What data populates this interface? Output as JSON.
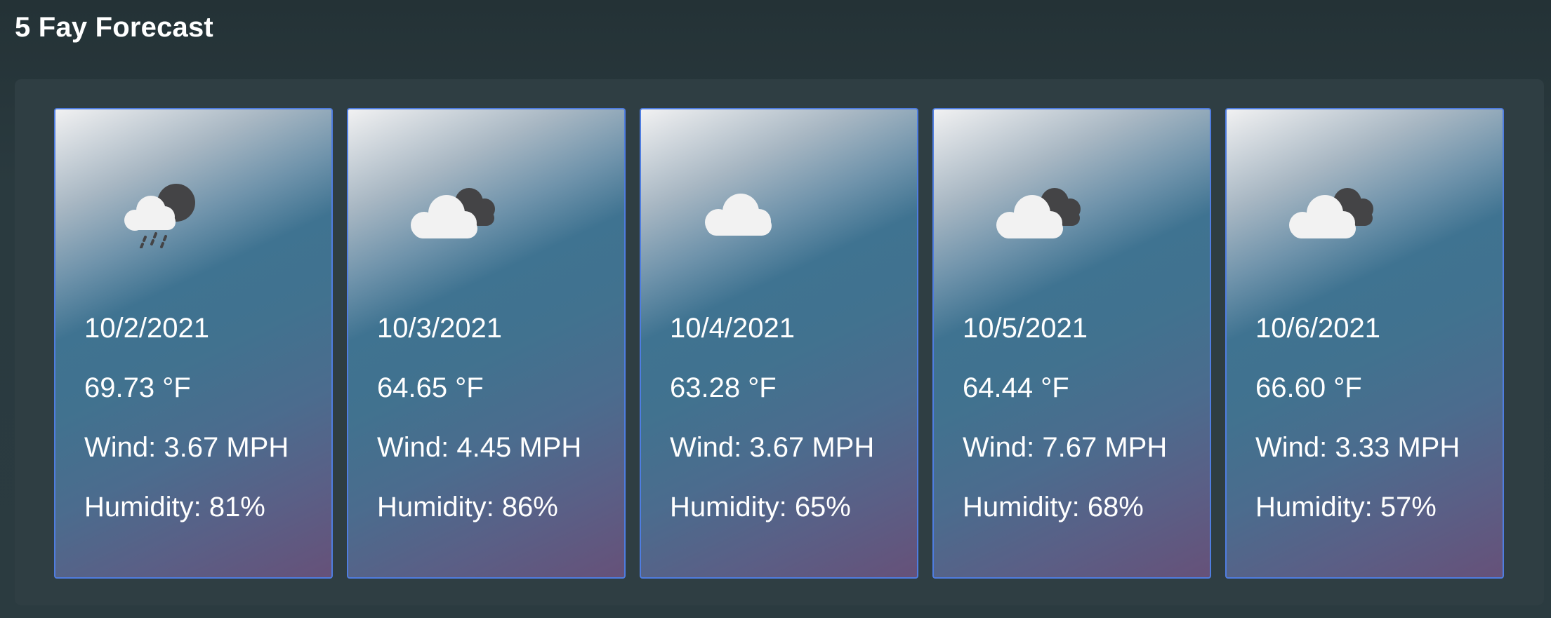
{
  "page": {
    "title": "5 Fay Forecast"
  },
  "forecast": {
    "days": [
      {
        "date": "10/2/2021",
        "temp": "69.73 °F",
        "wind": "Wind: 3.67 MPH",
        "humidity": "Humidity: 81%",
        "icon": "rain-cloud-night-icon"
      },
      {
        "date": "10/3/2021",
        "temp": "64.65 °F",
        "wind": "Wind: 4.45 MPH",
        "humidity": "Humidity: 86%",
        "icon": "broken-clouds-icon"
      },
      {
        "date": "10/4/2021",
        "temp": "63.28 °F",
        "wind": "Wind: 3.67 MPH",
        "humidity": "Humidity: 65%",
        "icon": "cloud-icon"
      },
      {
        "date": "10/5/2021",
        "temp": "64.44 °F",
        "wind": "Wind: 7.67 MPH",
        "humidity": "Humidity: 68%",
        "icon": "broken-clouds-icon"
      },
      {
        "date": "10/6/2021",
        "temp": "66.60 °F",
        "wind": "Wind: 3.33 MPH",
        "humidity": "Humidity: 57%",
        "icon": "broken-clouds-icon"
      }
    ]
  },
  "colors": {
    "page_background": "#2a3a3f",
    "panel_background": "#2f3e43",
    "card_border": "#4f7de0",
    "card_gradient_start": "#f1f1f2",
    "card_gradient_mid": "#41728f",
    "card_gradient_end": "#665179",
    "text": "#ffffff"
  }
}
